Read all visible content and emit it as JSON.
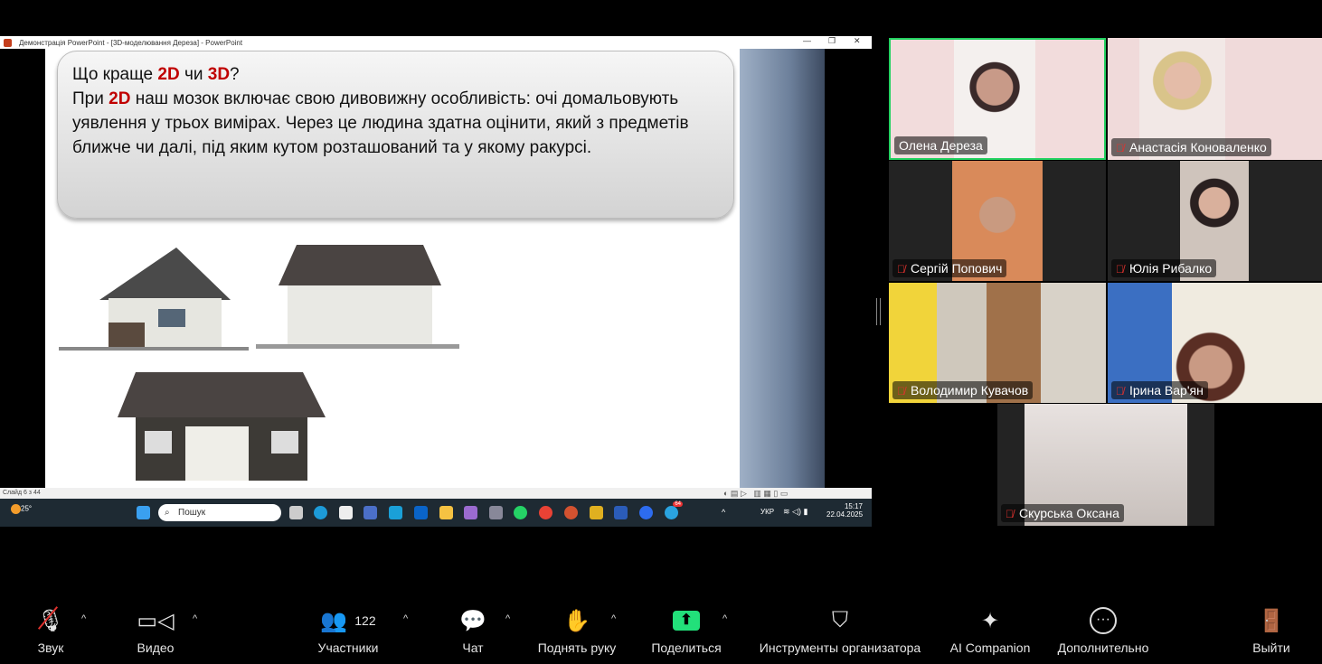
{
  "ppt": {
    "title": "Демонстрація PowerPoint - [3D-моделювання Дереза] - PowerPoint",
    "slide": {
      "line1_pre": "Що краще ",
      "line1_a": "2D",
      "line1_mid": " чи ",
      "line1_b": "3D",
      "line1_post": "?",
      "para_pre": "При ",
      "para_red": "2D",
      "para_post": " наш мозок включає свою дивовижну особливість: очі домальовують уявлення у трьох вимірах. Через це людина здатна оцінити, який з предметів ближче чи далі, під яким кутом розташований та у якому ракурсі."
    },
    "status": "Слайд 6 з 44",
    "taskbar": {
      "weather": "25°",
      "search_placeholder": "Пошук",
      "lang": "УКР",
      "time": "15:17",
      "date": "22.04.2025",
      "telegram_badge": "64"
    }
  },
  "participants": [
    {
      "name": "Олена Дереза",
      "muted": false,
      "active": true
    },
    {
      "name": "Анастасія Коноваленко",
      "muted": true
    },
    {
      "name": "Сергій Попович",
      "muted": true
    },
    {
      "name": "Юлія Рибалко",
      "muted": true
    },
    {
      "name": "Володимир Кувачов",
      "muted": true
    },
    {
      "name": "Ірина Вар'ян",
      "muted": true
    },
    {
      "name": "Скурська Оксана",
      "muted": true
    }
  ],
  "toolbar": {
    "audio": "Звук",
    "video": "Видео",
    "participants": "Участники",
    "participants_count": "122",
    "chat": "Чат",
    "raise_hand": "Поднять руку",
    "share": "Поделиться",
    "host_tools": "Инструменты организатора",
    "ai": "AI Companion",
    "more": "Дополнительно",
    "leave": "Выйти"
  },
  "colors": {
    "active_speaker": "#23d160",
    "share_green": "#22e07a",
    "leave_red": "#e0322e"
  }
}
